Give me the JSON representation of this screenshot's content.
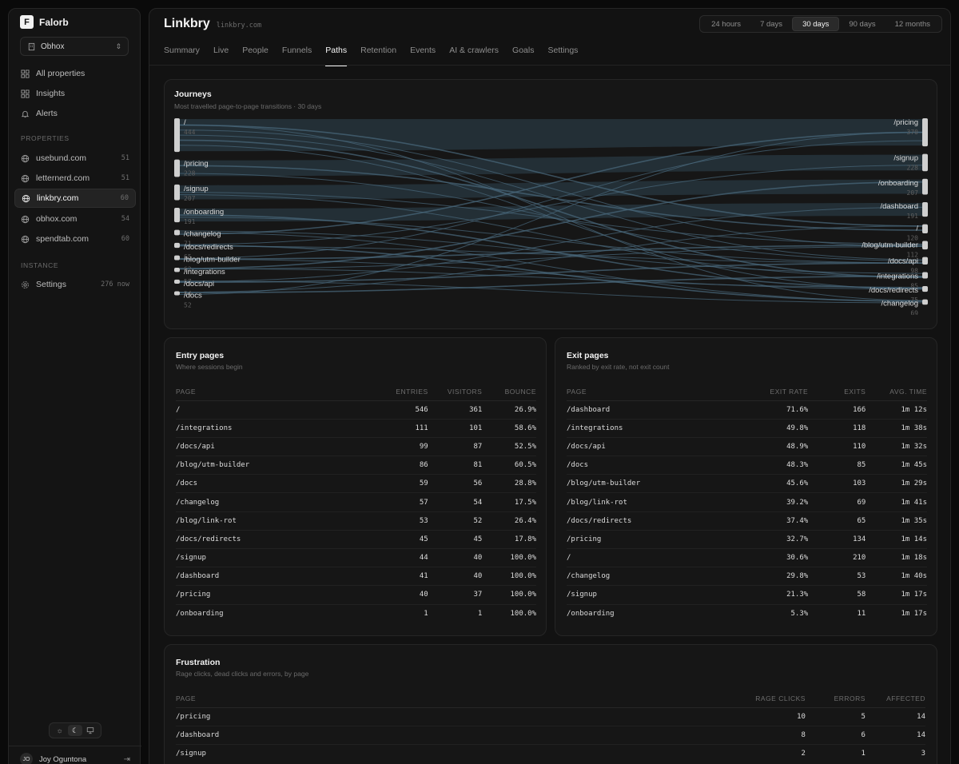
{
  "brand": {
    "logo_letter": "F",
    "name": "Falorb"
  },
  "org": {
    "name": "Obhox"
  },
  "nav": [
    {
      "label": "All properties",
      "icon": "grid-icon"
    },
    {
      "label": "Insights",
      "icon": "grid-icon"
    },
    {
      "label": "Alerts",
      "icon": "bell-icon"
    }
  ],
  "properties_label": "PROPERTIES",
  "properties": [
    {
      "label": "usebund.com",
      "count": "51",
      "active": false
    },
    {
      "label": "letternerd.com",
      "count": "51",
      "active": false
    },
    {
      "label": "linkbry.com",
      "count": "60",
      "active": true
    },
    {
      "label": "obhox.com",
      "count": "54",
      "active": false
    },
    {
      "label": "spendtab.com",
      "count": "60",
      "active": false
    }
  ],
  "instance_label": "INSTANCE",
  "settings": {
    "label": "Settings",
    "count": "276 now"
  },
  "user": {
    "initials": "JO",
    "name": "Joy Oguntona"
  },
  "header": {
    "title": "Linkbry",
    "domain": "linkbry.com"
  },
  "ranges": [
    "24 hours",
    "7 days",
    "30 days",
    "90 days",
    "12 months"
  ],
  "active_range": "30 days",
  "tabs": [
    "Summary",
    "Live",
    "People",
    "Funnels",
    "Paths",
    "Retention",
    "Events",
    "AI & crawlers",
    "Goals",
    "Settings"
  ],
  "active_tab": "Paths",
  "journeys": {
    "title": "Journeys",
    "subtitle": "Most travelled page-to-page transitions · 30 days",
    "left_nodes": [
      {
        "label": "/",
        "value": "444"
      },
      {
        "label": "/pricing",
        "value": "228"
      },
      {
        "label": "/signup",
        "value": "207"
      },
      {
        "label": "/onboarding",
        "value": "191"
      },
      {
        "label": "/changelog",
        "value": "71"
      },
      {
        "label": "/docs/redirects",
        "value": "65"
      },
      {
        "label": "/blog/utm-builder",
        "value": "62"
      },
      {
        "label": "/integrations",
        "value": "57"
      },
      {
        "label": "/docs/api",
        "value": "54"
      },
      {
        "label": "/docs",
        "value": "52"
      }
    ],
    "right_nodes": [
      {
        "label": "/pricing",
        "value": "370"
      },
      {
        "label": "/signup",
        "value": "228"
      },
      {
        "label": "/onboarding",
        "value": "207"
      },
      {
        "label": "/dashboard",
        "value": "191"
      },
      {
        "label": "/",
        "value": "120"
      },
      {
        "label": "/blog/utm-builder",
        "value": "112"
      },
      {
        "label": "/docs/api",
        "value": "98"
      },
      {
        "label": "/integrations",
        "value": "85"
      },
      {
        "label": "/docs/redirects",
        "value": "75"
      },
      {
        "label": "/changelog",
        "value": "69"
      }
    ]
  },
  "entry_pages": {
    "title": "Entry pages",
    "subtitle": "Where sessions begin",
    "columns": [
      "PAGE",
      "ENTRIES",
      "VISITORS",
      "BOUNCE"
    ],
    "rows": [
      [
        "/",
        "546",
        "361",
        "26.9%"
      ],
      [
        "/integrations",
        "111",
        "101",
        "58.6%"
      ],
      [
        "/docs/api",
        "99",
        "87",
        "52.5%"
      ],
      [
        "/blog/utm-builder",
        "86",
        "81",
        "60.5%"
      ],
      [
        "/docs",
        "59",
        "56",
        "28.8%"
      ],
      [
        "/changelog",
        "57",
        "54",
        "17.5%"
      ],
      [
        "/blog/link-rot",
        "53",
        "52",
        "26.4%"
      ],
      [
        "/docs/redirects",
        "45",
        "45",
        "17.8%"
      ],
      [
        "/signup",
        "44",
        "40",
        "100.0%"
      ],
      [
        "/dashboard",
        "41",
        "40",
        "100.0%"
      ],
      [
        "/pricing",
        "40",
        "37",
        "100.0%"
      ],
      [
        "/onboarding",
        "1",
        "1",
        "100.0%"
      ]
    ]
  },
  "exit_pages": {
    "title": "Exit pages",
    "subtitle": "Ranked by exit rate, not exit count",
    "columns": [
      "PAGE",
      "EXIT RATE",
      "EXITS",
      "AVG. TIME"
    ],
    "rows": [
      [
        "/dashboard",
        "71.6%",
        "166",
        "1m 12s"
      ],
      [
        "/integrations",
        "49.8%",
        "118",
        "1m 38s"
      ],
      [
        "/docs/api",
        "48.9%",
        "110",
        "1m 32s"
      ],
      [
        "/docs",
        "48.3%",
        "85",
        "1m 45s"
      ],
      [
        "/blog/utm-builder",
        "45.6%",
        "103",
        "1m 29s"
      ],
      [
        "/blog/link-rot",
        "39.2%",
        "69",
        "1m 41s"
      ],
      [
        "/docs/redirects",
        "37.4%",
        "65",
        "1m 35s"
      ],
      [
        "/pricing",
        "32.7%",
        "134",
        "1m 14s"
      ],
      [
        "/",
        "30.6%",
        "210",
        "1m 18s"
      ],
      [
        "/changelog",
        "29.8%",
        "53",
        "1m 40s"
      ],
      [
        "/signup",
        "21.3%",
        "58",
        "1m 17s"
      ],
      [
        "/onboarding",
        "5.3%",
        "11",
        "1m 17s"
      ]
    ]
  },
  "frustration": {
    "title": "Frustration",
    "subtitle": "Rage clicks, dead clicks and errors, by page",
    "columns": [
      "PAGE",
      "RAGE CLICKS",
      "ERRORS",
      "AFFECTED"
    ],
    "rows": [
      [
        "/pricing",
        "10",
        "5",
        "14"
      ],
      [
        "/dashboard",
        "8",
        "6",
        "14"
      ],
      [
        "/signup",
        "2",
        "1",
        "3"
      ]
    ]
  },
  "colors": {
    "accent": "#f5f5f5",
    "flow": "#4a6a7e",
    "band": "#26343c"
  }
}
